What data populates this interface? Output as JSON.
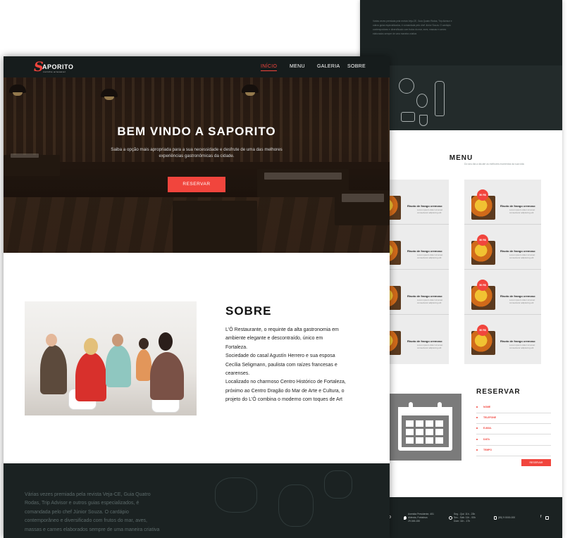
{
  "colors": {
    "accent": "#f1453d",
    "dark": "#1b2222",
    "nav": "#161c1c"
  },
  "brand": {
    "initial": "S",
    "name": "APORITO",
    "tagline": "cozinha artesanal"
  },
  "nav": {
    "items": [
      "INÍCIO",
      "MENU",
      "GALERIA",
      "SOBRE"
    ],
    "active": "INÍCIO"
  },
  "hero": {
    "title": "BEM VINDO A SAPORITO",
    "subtitle": "Saiba a opção mais apropriada para a sua necessidade e desfrute de uma das melhores experiências gastronômicas da cidade.",
    "button": "RESERVAR"
  },
  "about": {
    "title": "SOBRE",
    "text": "L'Ô Restaurante, o requinte da alta gastronomia em\nambiente elegante e descontraído, único em\nFortaleza.\nSociedade do casal Agustín Herrero e sua esposa\nCecília Seligmann, paulista com raízes francesas e\ncearenses.\nLocalizado no charmoso Centro Histórico de Fortaleza,\npróximo ao Centro Dragão do Mar de Arte e Cultura, o\nprojeto do L'Ô combina o moderno com toques de Art"
  },
  "footer_front": {
    "text": "Várias vezes premiada pela revista Veja-CE, Guia Quatro\nRodas, Trip Advisor e outros guias especializados, é\ncomandada pelo chef Júnior Souza. O cardápio\ncontemporâneo e diversificado com frutos do mar, aves,\nmassas e carnes elaborados sempre de uma maneira criativa"
  },
  "back": {
    "top_text": "Várias vezes premiada pela revista Veja-CE, Guia Quatro Rodas, Trip Advisor e outros guias especializados, é comandada pelo chef Júnior Souza. O cardápio contemporâneo e diversificado com frutos do mar, aves, massas e carnes elaborados sempre de uma maneira criativa",
    "band_text": "Do seu dia a dia até os melhores momentos da sua vida",
    "menu_title": "MENU",
    "menu_items": [
      {
        "name": "Risoto de frango cremoso",
        "desc": "Lorem ipsum dolor sit amet consectetur adipiscing elit",
        "price": "50 R$"
      },
      {
        "name": "Risoto de frango cremoso",
        "desc": "Lorem ipsum dolor sit amet consectetur adipiscing elit",
        "price": "50 R$"
      },
      {
        "name": "Risoto de frango cremoso",
        "desc": "Lorem ipsum dolor sit amet consectetur adipiscing elit",
        "price": "50 R$"
      },
      {
        "name": "Risoto de frango cremoso",
        "desc": "Lorem ipsum dolor sit amet consectetur adipiscing elit",
        "price": "50 R$"
      },
      {
        "name": "Risoto de frango cremoso",
        "desc": "Lorem ipsum dolor sit amet consectetur adipiscing elit",
        "price": "50 R$"
      },
      {
        "name": "Risoto de frango cremoso",
        "desc": "Lorem ipsum dolor sit amet consectetur adipiscing elit",
        "price": "50 R$"
      },
      {
        "name": "Risoto de frango cremoso",
        "desc": "Lorem ipsum dolor sit amet consectetur adipiscing elit",
        "price": "50 R$"
      },
      {
        "name": "Risoto de frango cremoso",
        "desc": "Lorem ipsum dolor sit amet consectetur adipiscing elit",
        "price": "50 R$"
      }
    ],
    "reserve_title": "RESERVAR",
    "reserve_fields": [
      "NOME",
      "TELEFONE",
      "E-MAIL",
      "DATA",
      "TEMPO"
    ],
    "reserve_button": "RESERVAR",
    "footer": {
      "brand_fragment": "TO",
      "address": "Avenida Presidente, 401\nAldeota, Fortaleza\n29.045-150",
      "hours": "Seg - Qui: 11h - 23h\nSex - Sáb: 11h - 00h\nDom: 11h - 17h",
      "phone": "(85) 9 0000-000"
    }
  }
}
